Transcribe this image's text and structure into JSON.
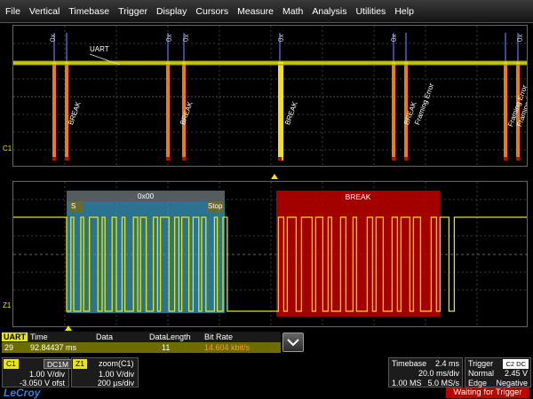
{
  "menu": [
    "File",
    "Vertical",
    "Timebase",
    "Trigger",
    "Display",
    "Cursors",
    "Measure",
    "Math",
    "Analysis",
    "Utilities",
    "Help"
  ],
  "upper_trace": {
    "channel_label": "C1",
    "trace_label": "UART",
    "annotations": [
      "0x",
      "0x",
      "0x",
      "0x",
      "0x",
      "0x"
    ],
    "event_labels": [
      "BREAK",
      "BREAK",
      "BREAK",
      "BREAK",
      "Framing Error",
      "Framing Error",
      "Framing Error"
    ]
  },
  "zoom_trace": {
    "channel_label": "Z1",
    "packet1_label": "0x00",
    "packet1_start": "S",
    "packet1_stop": "Stop",
    "packet2_label": "BREAK"
  },
  "decode_table": {
    "title": "UART",
    "columns": [
      "Time",
      "Data",
      "DataLength",
      "Bit Rate"
    ],
    "row": {
      "index": "29",
      "time": "92.84437 ms",
      "data": "",
      "length": "11",
      "bitrate": "14.604 kbit/s"
    }
  },
  "c1_descriptor": {
    "label": "C1",
    "coupling": "DC1M",
    "scale": "1.00 V/div",
    "offset": "-3.050 V ofst"
  },
  "z1_descriptor": {
    "label": "Z1",
    "title": "zoom(C1)",
    "scale": "1.00 V/div",
    "timebase": "200 µs/div"
  },
  "timebase": {
    "label": "Timebase",
    "delay": "2.4 ms",
    "per_div": "20.0 ms/div",
    "samples": "1.00 MS",
    "rate": "5.0 MS/s"
  },
  "trigger": {
    "label": "Trigger",
    "source_tag": "C2 DC",
    "mode": "Normal",
    "level": "2.45 V",
    "type": "Edge",
    "slope": "Negative"
  },
  "brand": "LeCroy",
  "status": "Waiting for Trigger",
  "colors": {
    "trace": "#e8e800",
    "zoom_box1": "#3aa0c8",
    "zoom_box2": "#c00000",
    "orange": "#f07a10"
  }
}
